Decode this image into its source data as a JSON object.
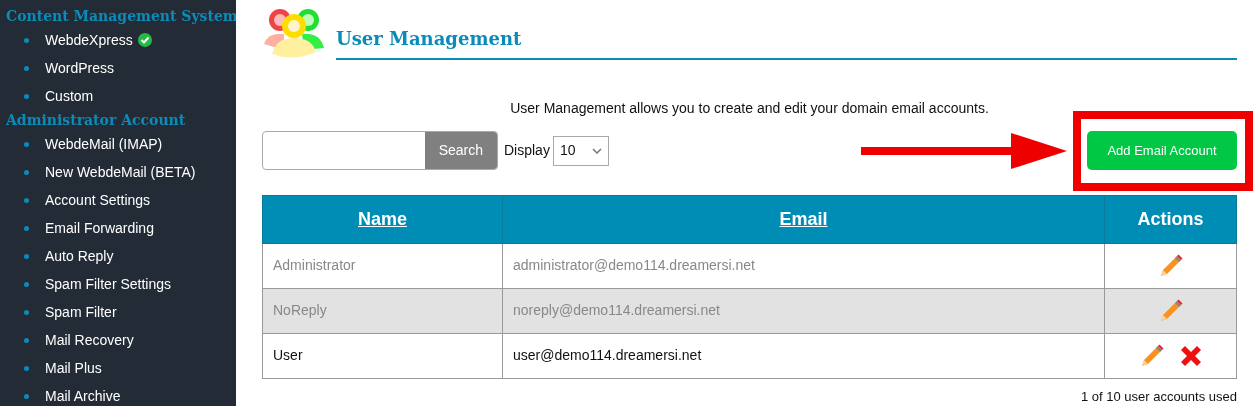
{
  "sidebar": {
    "sections": [
      {
        "heading": "Content Management System",
        "items": [
          {
            "label": "WebdeXpress",
            "verified": true
          },
          {
            "label": "WordPress",
            "verified": false
          },
          {
            "label": "Custom",
            "verified": false
          }
        ]
      },
      {
        "heading": "Administrator Account",
        "items": [
          {
            "label": "WebdeMail (IMAP)",
            "verified": false
          },
          {
            "label": "New WebdeMail (BETA)",
            "verified": false
          },
          {
            "label": "Account Settings",
            "verified": false
          },
          {
            "label": "Email Forwarding",
            "verified": false
          },
          {
            "label": "Auto Reply",
            "verified": false
          },
          {
            "label": "Spam Filter Settings",
            "verified": false
          },
          {
            "label": "Spam Filter",
            "verified": false
          },
          {
            "label": "Mail Recovery",
            "verified": false
          },
          {
            "label": "Mail Plus",
            "verified": false
          },
          {
            "label": "Mail Archive",
            "verified": false
          }
        ]
      }
    ]
  },
  "page": {
    "title": "User Management",
    "description": "User Management allows you to create and edit your domain email accounts."
  },
  "toolbar": {
    "search_button": "Search",
    "display_label": "Display",
    "display_value": "10",
    "add_button": "Add Email Account",
    "highlighted": true
  },
  "table": {
    "columns": [
      "Name",
      "Email",
      "Actions"
    ],
    "rows": [
      {
        "name": "Administrator",
        "email": "administrator@demo114.dreamersi.net",
        "disabled": true,
        "deletable": false
      },
      {
        "name": "NoReply",
        "email": "noreply@demo114.dreamersi.net",
        "disabled": true,
        "deletable": false
      },
      {
        "name": "User",
        "email": "user@demo114.dreamersi.net",
        "disabled": false,
        "deletable": true
      }
    ]
  },
  "footer": "1 of 10 user accounts used"
}
